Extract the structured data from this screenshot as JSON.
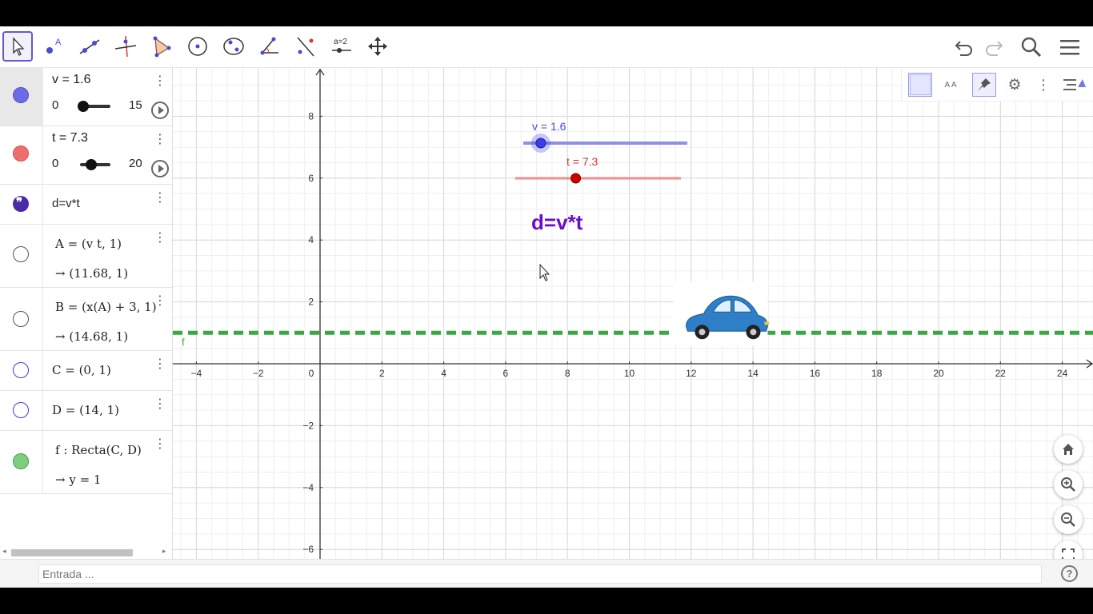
{
  "toolbar": {
    "tools": [
      "move-tool",
      "point-tool",
      "line-tool",
      "perpendicular-tool",
      "polygon-tool",
      "circle-tool",
      "conic-tool",
      "angle-tool",
      "reflect-tool",
      "slider-tool",
      "move-graphics-tool"
    ],
    "slider_tool_text": "a=2",
    "point_tool_letter": "A",
    "right": [
      "undo-icon",
      "redo-icon",
      "search-icon",
      "menu-icon"
    ]
  },
  "algebra": {
    "items": [
      {
        "label": "v = 1.6",
        "min": "0",
        "max": "15",
        "value": 1.6,
        "range": [
          0,
          15
        ],
        "color": "#6b6be6"
      },
      {
        "label": "t = 7.3",
        "min": "0",
        "max": "20",
        "value": 7.3,
        "range": [
          0,
          20
        ],
        "color": "#ee6e6e"
      },
      {
        "label": "d=v*t",
        "color": "#4b2aa8"
      },
      {
        "def": "A = (v t, 1)",
        "val": "→ (11.68, 1)"
      },
      {
        "def": "B = (x(A) + 3, 1)",
        "val": "→ (14.68, 1)"
      },
      {
        "def": "C = (0, 1)"
      },
      {
        "def": "D = (14, 1)"
      },
      {
        "def": "f : Recta(C, D)",
        "val": "→ y = 1",
        "color": "#66bb6a"
      }
    ]
  },
  "graphics": {
    "slider_v_label": "v = 1.6",
    "slider_t_label": "t = 7.3",
    "text_label": "d=v*t",
    "line_label": "f",
    "x_ticks": [
      "−4",
      "−2",
      "0",
      "2",
      "4",
      "6",
      "8",
      "10",
      "12",
      "14",
      "16",
      "18",
      "20",
      "22",
      "24"
    ],
    "y_ticks": [
      "8",
      "6",
      "4",
      "2",
      "−2",
      "−4",
      "−6"
    ],
    "style_bar": [
      "graphics-view-toggle",
      "text-size-icon",
      "pin-icon",
      "gear-icon",
      "more-icon",
      "toggle-style-bar-icon"
    ],
    "style_bar_text": "A A",
    "nav_buttons": [
      "home-icon",
      "zoom-in-icon",
      "zoom-out-icon",
      "fullscreen-icon"
    ],
    "colors": {
      "blue": "#3d3de6",
      "red": "#d10000",
      "green": "#3aa842",
      "purple": "#6a0dcc"
    }
  },
  "input": {
    "placeholder": "Entrada ...",
    "help": "?"
  }
}
